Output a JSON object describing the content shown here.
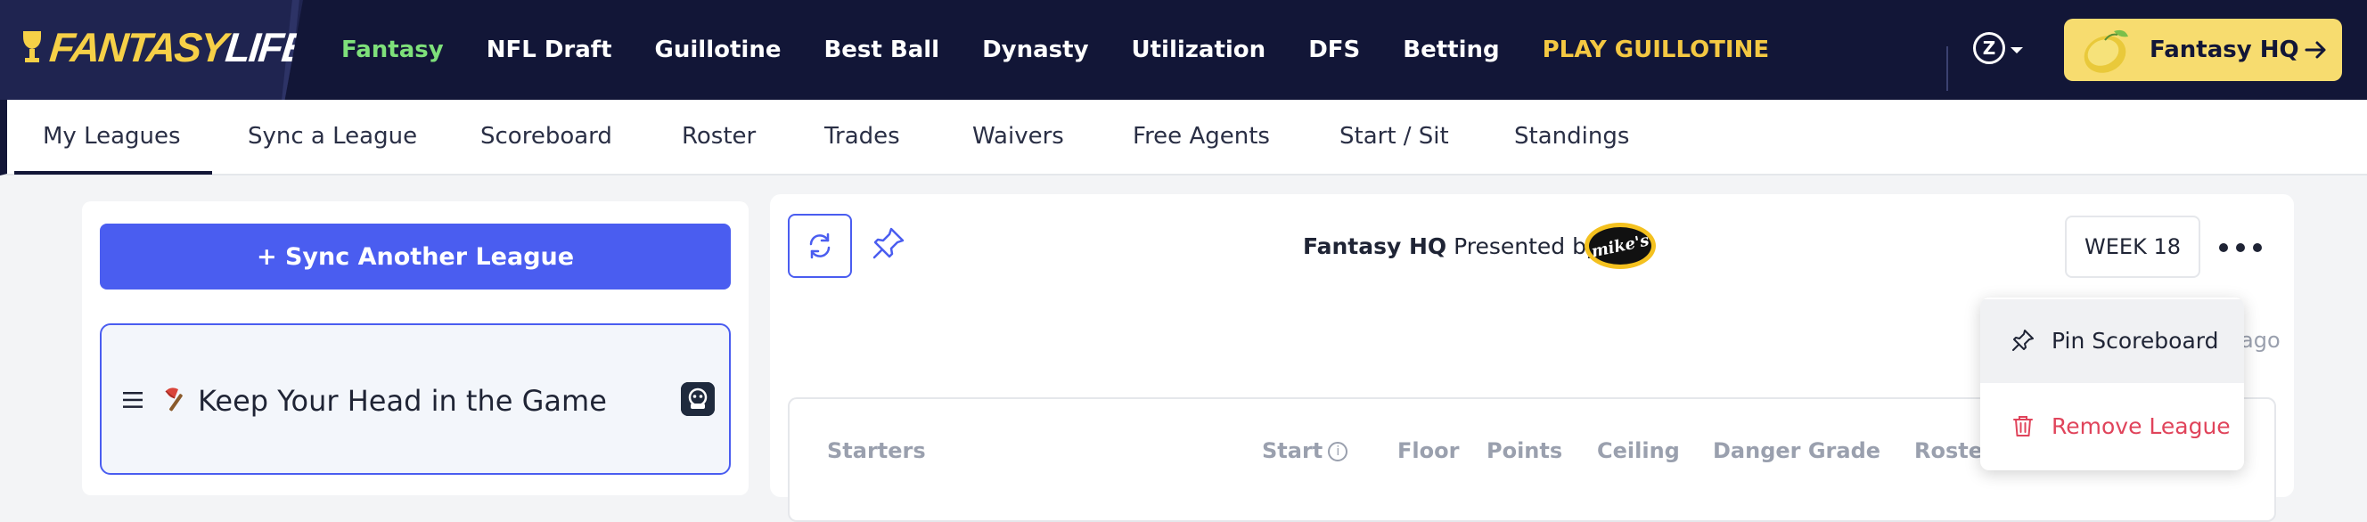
{
  "brand": {
    "logo_main": "FANTASY",
    "logo_accent": "LIFE"
  },
  "nav": {
    "items": [
      "Fantasy",
      "NFL Draft",
      "Guillotine",
      "Best Ball",
      "Dynasty",
      "Utilization",
      "DFS",
      "Betting",
      "PLAY GUILLOTINE"
    ],
    "active": "Fantasy"
  },
  "user": {
    "initial": "Z"
  },
  "hq_button": {
    "label": "Fantasy HQ"
  },
  "tabs": [
    "My Leagues",
    "Sync a League",
    "Scoreboard",
    "Roster",
    "Trades",
    "Waivers",
    "Free Agents",
    "Start / Sit",
    "Standings"
  ],
  "sidebar": {
    "sync_button": "+ Sync Another League",
    "league": {
      "name": "Keep Your Head in the Game"
    }
  },
  "main": {
    "title_bold": "Fantasy HQ",
    "title_rest": "Presented by",
    "sponsor": "mike's",
    "week": "WEEK 18",
    "updated_suffix": "ago",
    "columns": [
      "Starters",
      "Start",
      "Floor",
      "Points",
      "Ceiling",
      "Danger Grade",
      "Roster"
    ]
  },
  "dropdown": {
    "pin": "Pin Scoreboard",
    "remove": "Remove League"
  },
  "colors": {
    "nav_bg": "#121637",
    "active_nav": "#7ee07a",
    "play_link": "#f4c842",
    "hq_button": "#f7dc6f",
    "primary": "#4a5df0",
    "danger": "#e0445b"
  }
}
